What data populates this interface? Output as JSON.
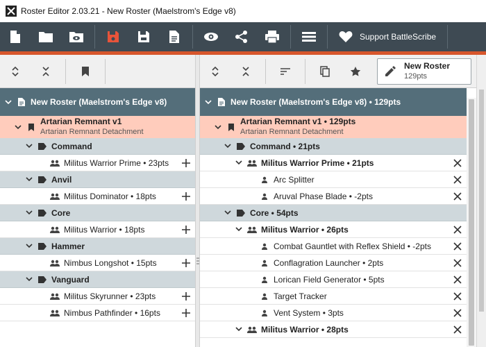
{
  "window": {
    "title": "Roster Editor 2.03.21 - New Roster (Maelstrom's Edge v8)"
  },
  "toolbar": {
    "support_label": "Support BattleScribe"
  },
  "colors": {
    "toolbar_bg": "#3e4a53",
    "accent": "#d7562c",
    "header_bg": "#546e7a",
    "force_bg": "#ffccbc",
    "category_bg": "#cfd8dc"
  },
  "left": {
    "header": "New Roster (Maelstrom's Edge v8)",
    "force": {
      "name": "Artarian Remnant v1",
      "detachment": "Artarian Remnant Detachment"
    },
    "categories": [
      {
        "name": "Command",
        "units": [
          "Militus Warrior Prime • 23pts"
        ]
      },
      {
        "name": "Anvil",
        "units": [
          "Militus Dominator • 18pts"
        ]
      },
      {
        "name": "Core",
        "units": [
          "Militus Warrior • 18pts"
        ]
      },
      {
        "name": "Hammer",
        "units": [
          "Nimbus Longshot • 15pts"
        ]
      },
      {
        "name": "Vanguard",
        "units": [
          "Militus Skyrunner • 23pts",
          "Nimbus Pathfinder • 16pts"
        ]
      }
    ]
  },
  "right": {
    "roster_button": {
      "name": "New Roster",
      "points": "129pts"
    },
    "header": "New Roster (Maelstrom's Edge v8) • 129pts",
    "force": {
      "name": "Artarian Remnant v1 • 129pts",
      "detachment": "Artarian Remnant Detachment"
    },
    "rows": [
      {
        "type": "cat",
        "label": "Command • 21pts"
      },
      {
        "type": "unit",
        "label": "Militus Warrior Prime • 21pts"
      },
      {
        "type": "upgrade",
        "label": "Arc Splitter"
      },
      {
        "type": "upgrade",
        "label": "Aruval Phase Blade • -2pts"
      },
      {
        "type": "cat",
        "label": "Core • 54pts"
      },
      {
        "type": "unit",
        "label": "Militus Warrior • 26pts"
      },
      {
        "type": "upgrade",
        "label": "Combat Gauntlet with Reflex Shield • -2pts"
      },
      {
        "type": "upgrade",
        "label": "Conflagration Launcher • 2pts"
      },
      {
        "type": "upgrade",
        "label": "Lorican Field Generator • 5pts"
      },
      {
        "type": "upgrade",
        "label": "Target Tracker"
      },
      {
        "type": "upgrade",
        "label": "Vent System • 3pts"
      },
      {
        "type": "unit",
        "label": "Militus Warrior • 28pts"
      }
    ]
  }
}
